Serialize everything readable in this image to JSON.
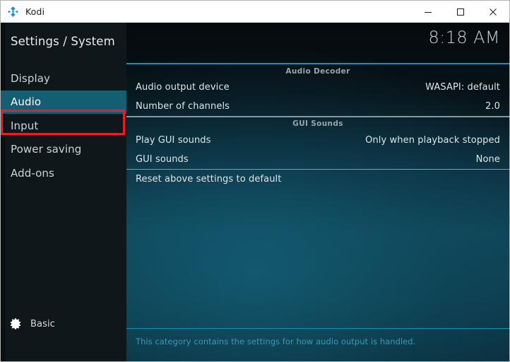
{
  "window": {
    "title": "Kodi",
    "logo_icon": "kodi-logo-icon",
    "controls": {
      "minimize": "minimize-icon",
      "maximize": "maximize-icon",
      "close": "close-icon"
    }
  },
  "sidebar": {
    "title": "Settings / System",
    "items": [
      {
        "label": "Display",
        "selected": false
      },
      {
        "label": "Audio",
        "selected": true
      },
      {
        "label": "Input",
        "selected": false
      },
      {
        "label": "Power saving",
        "selected": false
      },
      {
        "label": "Add-ons",
        "selected": false
      }
    ],
    "footer": {
      "icon": "gear-icon",
      "label": "Basic"
    },
    "selection_highlight_color": "#135e70",
    "annotation_color": "#ee1c25"
  },
  "content": {
    "clock": "8:18 AM",
    "sections": [
      {
        "header": "Audio Decoder",
        "rows": [
          {
            "label": "Audio output device",
            "value": "WASAPI: default"
          },
          {
            "label": "Number of channels",
            "value": "2.0"
          }
        ]
      },
      {
        "header": "GUI Sounds",
        "rows": [
          {
            "label": "Play GUI sounds",
            "value": "Only when playback stopped"
          },
          {
            "label": "GUI sounds",
            "value": "None"
          }
        ]
      },
      {
        "header": "",
        "rows": [
          {
            "label": "Reset above settings to default",
            "value": ""
          }
        ]
      }
    ],
    "help_text": "This category contains the settings for how audio output is handled.",
    "accent_color": "#1d8fae"
  }
}
